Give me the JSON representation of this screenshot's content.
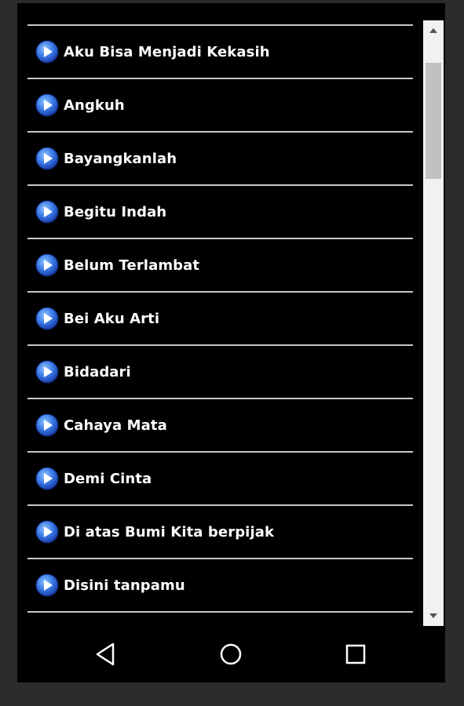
{
  "song_list": {
    "items": [
      {
        "label": "Aku Bisa Menjadi Kekasih"
      },
      {
        "label": "Angkuh"
      },
      {
        "label": "Bayangkanlah"
      },
      {
        "label": "Begitu Indah"
      },
      {
        "label": "Belum Terlambat"
      },
      {
        "label": "Bei Aku Arti"
      },
      {
        "label": "Bidadari"
      },
      {
        "label": "Cahaya Mata"
      },
      {
        "label": "Demi Cinta"
      },
      {
        "label": "Di atas Bumi Kita berpijak"
      },
      {
        "label": "Disini tanpamu"
      }
    ]
  },
  "icons": {
    "item_icon": "play-icon",
    "nav_back": "back-triangle-icon",
    "nav_home": "home-circle-icon",
    "nav_recents": "recents-square-icon",
    "scroll_up": "scroll-up-arrow-icon",
    "scroll_down": "scroll-down-arrow-icon"
  },
  "colors": {
    "background": "#000000",
    "text": "#ffffff",
    "divider": "#c8c8c8",
    "play_icon": "#3b7be8",
    "scrollbar_track": "#f1f1f1",
    "scrollbar_thumb": "#c1c1c1"
  }
}
